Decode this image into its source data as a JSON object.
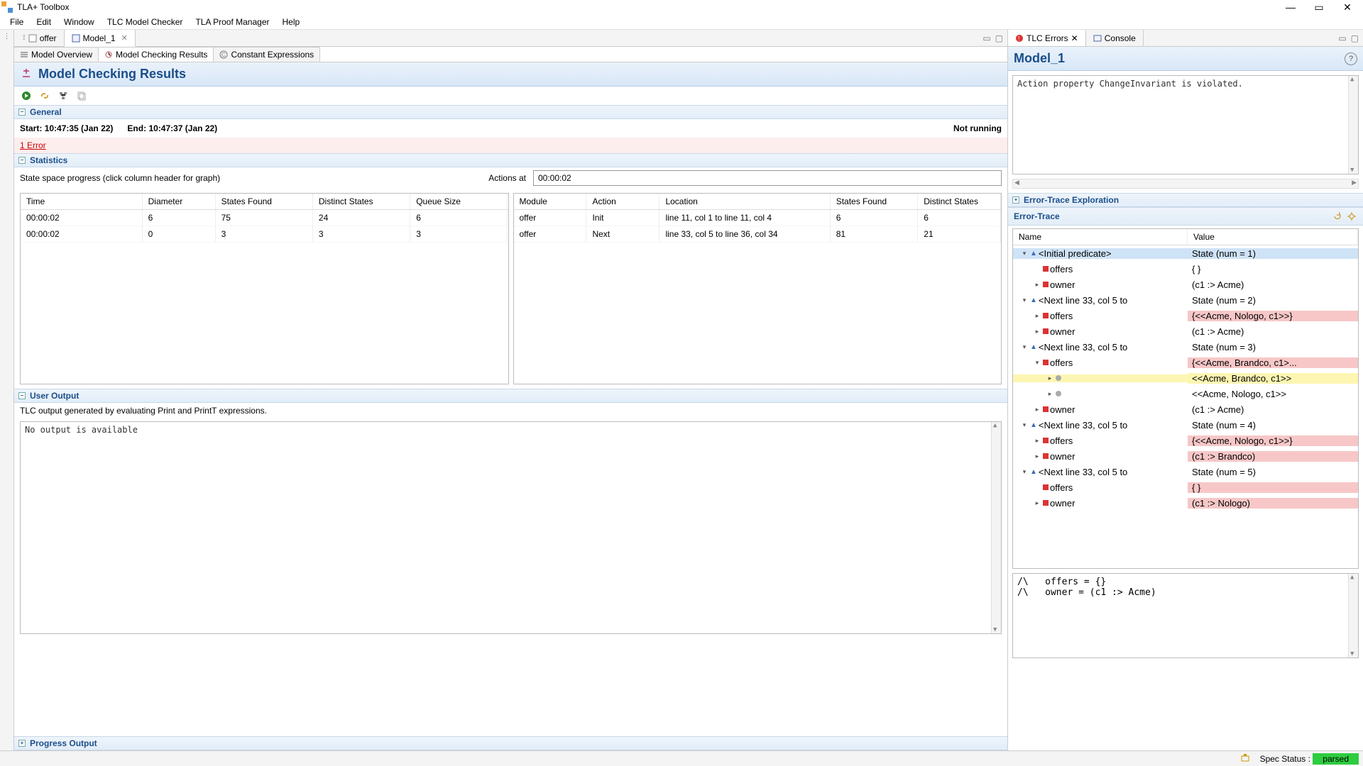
{
  "app_title": "TLA+ Toolbox",
  "menus": [
    "File",
    "Edit",
    "Window",
    "TLC Model Checker",
    "TLA Proof Manager",
    "Help"
  ],
  "left_tabs": [
    {
      "label": "offer",
      "active": false
    },
    {
      "label": "Model_1",
      "active": true
    }
  ],
  "inner_tabs": [
    {
      "label": "Model Overview",
      "active": false
    },
    {
      "label": "Model Checking Results",
      "active": true
    },
    {
      "label": "Constant Expressions",
      "active": false
    }
  ],
  "results_title": "Model Checking Results",
  "general": {
    "section": "General",
    "start_label": "Start:",
    "start_value": "10:47:35 (Jan 22)",
    "end_label": "End:",
    "end_value": "10:47:37 (Jan 22)",
    "status": "Not running",
    "error_link": "1 Error"
  },
  "statistics": {
    "section": "Statistics",
    "progress_label": "State space progress (click column header for graph)",
    "actions_label": "Actions at",
    "actions_value": "00:00:02",
    "progress_cols": [
      "Time",
      "Diameter",
      "States Found",
      "Distinct States",
      "Queue Size"
    ],
    "progress_rows": [
      [
        "00:00:02",
        "6",
        "75",
        "24",
        "6"
      ],
      [
        "00:00:02",
        "0",
        "3",
        "3",
        "3"
      ]
    ],
    "action_cols": [
      "Module",
      "Action",
      "Location",
      "States Found",
      "Distinct States"
    ],
    "action_rows": [
      [
        "offer",
        "Init",
        "line 11, col 1 to line 11, col 4",
        "6",
        "6"
      ],
      [
        "offer",
        "Next",
        "line 33, col 5 to line 36, col 34",
        "81",
        "21"
      ]
    ]
  },
  "user_output": {
    "section": "User Output",
    "desc": "TLC output generated by evaluating Print and PrintT expressions.",
    "body": "No output is available"
  },
  "progress_output": {
    "section": "Progress Output"
  },
  "right_tabs": [
    {
      "label": "TLC Errors",
      "active": true
    },
    {
      "label": "Console",
      "active": false
    }
  ],
  "model_name": "Model_1",
  "error_message": "Action property ChangeInvariant is violated.",
  "trace_exp_section": "Error-Trace Exploration",
  "trace_section": "Error-Trace",
  "trace_cols": [
    "Name",
    "Value"
  ],
  "trace": [
    {
      "depth": 0,
      "twist": "v",
      "up": true,
      "sq": "",
      "name": "<Initial predicate>",
      "val": "State (num = 1)",
      "cls": "sel"
    },
    {
      "depth": 1,
      "twist": "",
      "up": false,
      "sq": "red",
      "name": "offers",
      "val": "{ }",
      "cls": ""
    },
    {
      "depth": 1,
      "twist": ">",
      "up": false,
      "sq": "red",
      "name": "owner",
      "val": "(c1 :> Acme)",
      "cls": ""
    },
    {
      "depth": 0,
      "twist": "v",
      "up": true,
      "sq": "",
      "name": "<Next line 33, col 5 to",
      "val": "State (num = 2)",
      "cls": ""
    },
    {
      "depth": 1,
      "twist": ">",
      "up": false,
      "sq": "red",
      "name": "offers",
      "val": "{<<Acme, Nologo, c1>>}",
      "cls": "pink"
    },
    {
      "depth": 1,
      "twist": ">",
      "up": false,
      "sq": "red",
      "name": "owner",
      "val": "(c1 :> Acme)",
      "cls": ""
    },
    {
      "depth": 0,
      "twist": "v",
      "up": true,
      "sq": "",
      "name": "<Next line 33, col 5 to",
      "val": "State (num = 3)",
      "cls": ""
    },
    {
      "depth": 1,
      "twist": "v",
      "up": false,
      "sq": "red",
      "name": "offers",
      "val": "{<<Acme, Brandco, c1>...",
      "cls": "pink"
    },
    {
      "depth": 2,
      "twist": ">",
      "up": false,
      "sq": "gray",
      "name": "",
      "val": "<<Acme, Brandco, c1>>",
      "cls": "yellow"
    },
    {
      "depth": 2,
      "twist": ">",
      "up": false,
      "sq": "gray",
      "name": "",
      "val": "<<Acme, Nologo, c1>>",
      "cls": ""
    },
    {
      "depth": 1,
      "twist": ">",
      "up": false,
      "sq": "red",
      "name": "owner",
      "val": "(c1 :> Acme)",
      "cls": ""
    },
    {
      "depth": 0,
      "twist": "v",
      "up": true,
      "sq": "",
      "name": "<Next line 33, col 5 to",
      "val": "State (num = 4)",
      "cls": ""
    },
    {
      "depth": 1,
      "twist": ">",
      "up": false,
      "sq": "red",
      "name": "offers",
      "val": "{<<Acme, Nologo, c1>>}",
      "cls": "pink"
    },
    {
      "depth": 1,
      "twist": ">",
      "up": false,
      "sq": "red",
      "name": "owner",
      "val": "(c1 :> Brandco)",
      "cls": "pink"
    },
    {
      "depth": 0,
      "twist": "v",
      "up": true,
      "sq": "",
      "name": "<Next line 33, col 5 to",
      "val": "State (num = 5)",
      "cls": ""
    },
    {
      "depth": 1,
      "twist": "",
      "up": false,
      "sq": "red",
      "name": "offers",
      "val": "{ }",
      "cls": "pink"
    },
    {
      "depth": 1,
      "twist": ">",
      "up": false,
      "sq": "red",
      "name": "owner",
      "val": "(c1 :> Nologo)",
      "cls": "pink"
    }
  ],
  "state_text": "/\\   offers = {}\n/\\   owner = (c1 :> Acme)",
  "status_bar": {
    "spec_label": "Spec Status :",
    "spec_value": "parsed"
  }
}
